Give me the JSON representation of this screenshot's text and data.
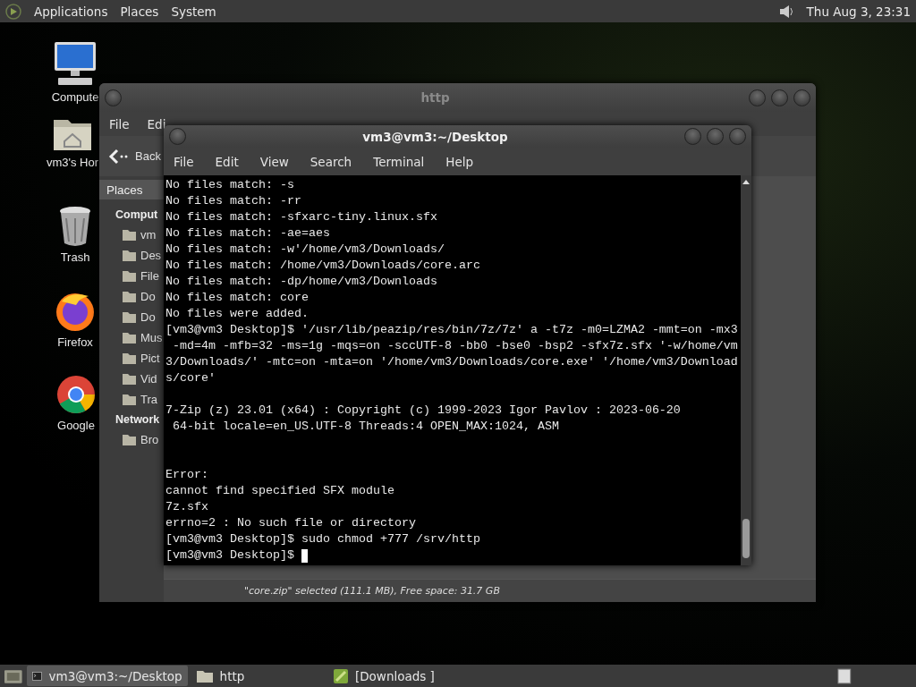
{
  "top_panel": {
    "menus": [
      "Applications",
      "Places",
      "System"
    ],
    "clock": "Thu Aug  3, 23:31"
  },
  "desktop_icons": [
    {
      "label": "Compute",
      "kind": "computer"
    },
    {
      "label": "vm3's Hor",
      "kind": "home"
    },
    {
      "label": "Trash",
      "kind": "trash"
    },
    {
      "label": "Firefox",
      "kind": "firefox"
    },
    {
      "label": "Google",
      "kind": "chrome"
    }
  ],
  "file_manager": {
    "title": "http",
    "menus": [
      "File",
      "Edi"
    ],
    "back": "Back",
    "sidebar_tab": "Places",
    "sections": [
      {
        "heading": "Comput",
        "items": [
          "vm",
          "Des",
          "File",
          "Do",
          "Do",
          "Mus",
          "Pict",
          "Vid",
          "Tra"
        ]
      },
      {
        "heading": "Network",
        "items": [
          "Bro"
        ]
      }
    ],
    "status": "\"core.zip\" selected (111.1 MB), Free space: 31.7 GB"
  },
  "terminal": {
    "title": "vm3@vm3:~/Desktop",
    "menus": [
      "File",
      "Edit",
      "View",
      "Search",
      "Terminal",
      "Help"
    ],
    "cursor": true,
    "blocks": [
      {
        "kind": "plain",
        "lines": [
          "No files match: -s",
          "No files match: -rr",
          "No files match: -sfxarc-tiny.linux.sfx",
          "No files match: -ae=aes",
          "No files match: -w'/home/vm3/Downloads/",
          "No files match: /home/vm3/Downloads/core.arc",
          "No files match: -dp/home/vm3/Downloads",
          "No files match: core",
          "No files were added.",
          "[vm3@vm3 Desktop]$ '/usr/lib/peazip/res/bin/7z/7z' a -t7z -m0=LZMA2 -mmt=on -mx3",
          " -md=4m -mfb=32 -ms=1g -mqs=on -sccUTF-8 -bb0 -bse0 -bsp2 -sfx7z.sfx '-w/home/vm",
          "3/Downloads/' -mtc=on -mta=on '/home/vm3/Downloads/core.exe' '/home/vm3/Download",
          "s/core'"
        ]
      },
      {
        "kind": "spaced",
        "lines": [
          "7-Zip (z) 23.01 (x64) : Copyright (c) 1999-2023 Igor Pavlov : 2023-06-20",
          " 64-bit locale=en_US.UTF-8 Threads:4 OPEN_MAX:1024, ASM"
        ]
      },
      {
        "kind": "wide",
        "lines": [
          "Error:",
          "cannot find specified SFX module",
          "7z.sfx",
          "errno=2 : No such file or directory",
          "[vm3@vm3 Desktop]$ sudo chmod +777 /srv/http",
          "[vm3@vm3 Desktop]$ "
        ]
      }
    ]
  },
  "taskbar": [
    {
      "label": "vm3@vm3:~/Desktop",
      "kind": "terminal",
      "selected": true
    },
    {
      "label": "http",
      "kind": "folder",
      "selected": false
    },
    {
      "label": "[Downloads ]",
      "kind": "app",
      "selected": false
    }
  ]
}
